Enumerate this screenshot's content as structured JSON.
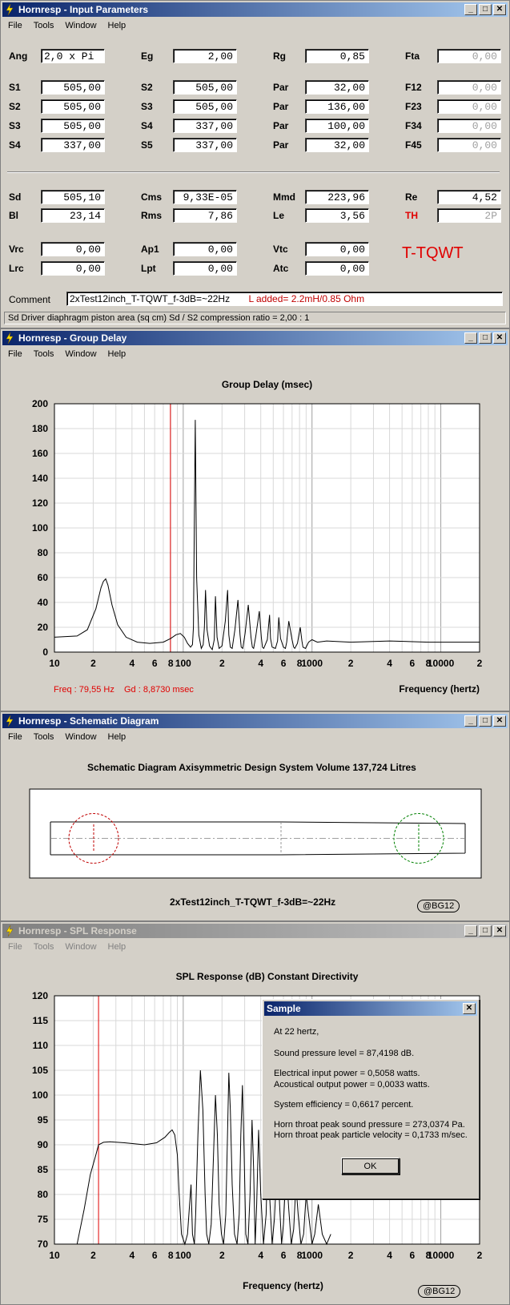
{
  "win1": {
    "title": "Hornresp - Input Parameters",
    "menu": [
      "File",
      "Tools",
      "Window",
      "Help"
    ],
    "rows1": [
      [
        {
          "l": "Ang",
          "v": "2,0 x Pi",
          "left": true
        },
        {
          "l": "Eg",
          "v": "2,00"
        },
        {
          "l": "Rg",
          "v": "0,85"
        },
        {
          "l": "Fta",
          "v": "0,00",
          "dis": true
        }
      ],
      [
        {
          "l": "S1",
          "v": "505,00"
        },
        {
          "l": "S2",
          "v": "505,00"
        },
        {
          "l": "Par",
          "v": "32,00"
        },
        {
          "l": "F12",
          "v": "0,00",
          "dis": true
        }
      ],
      [
        {
          "l": "S2",
          "v": "505,00"
        },
        {
          "l": "S3",
          "v": "505,00"
        },
        {
          "l": "Par",
          "v": "136,00"
        },
        {
          "l": "F23",
          "v": "0,00",
          "dis": true
        }
      ],
      [
        {
          "l": "S3",
          "v": "505,00"
        },
        {
          "l": "S4",
          "v": "337,00"
        },
        {
          "l": "Par",
          "v": "100,00"
        },
        {
          "l": "F34",
          "v": "0,00",
          "dis": true
        }
      ],
      [
        {
          "l": "S4",
          "v": "337,00"
        },
        {
          "l": "S5",
          "v": "337,00"
        },
        {
          "l": "Par",
          "v": "32,00"
        },
        {
          "l": "F45",
          "v": "0,00",
          "dis": true
        }
      ]
    ],
    "rows2": [
      [
        {
          "l": "Sd",
          "v": "505,10"
        },
        {
          "l": "Cms",
          "v": "9,33E-05"
        },
        {
          "l": "Mmd",
          "v": "223,96"
        },
        {
          "l": "Re",
          "v": "4,52"
        }
      ],
      [
        {
          "l": "Bl",
          "v": "23,14"
        },
        {
          "l": "Rms",
          "v": "7,86"
        },
        {
          "l": "Le",
          "v": "3,56"
        },
        {
          "l": "TH",
          "v": "2P",
          "dis": true,
          "red": true
        }
      ],
      [
        {
          "l": "Vrc",
          "v": "0,00"
        },
        {
          "l": "Ap1",
          "v": "0,00"
        },
        {
          "l": "Vtc",
          "v": "0,00"
        }
      ],
      [
        {
          "l": "Lrc",
          "v": "0,00"
        },
        {
          "l": "Lpt",
          "v": "0,00"
        },
        {
          "l": "Atc",
          "v": "0,00"
        }
      ]
    ],
    "big_label": "T-TQWT",
    "comment_label": "Comment",
    "comment_value": "2xTest12inch_T-TQWT_f-3dB=~22Hz",
    "comment_note": "L added= 2.2mH/0.85 Ohm",
    "status": "Sd   Driver diaphragm piston area  (sq cm)   Sd / S2 compression ratio = 2,00 : 1"
  },
  "win2": {
    "title": "Hornresp - Group Delay",
    "menu": [
      "File",
      "Tools",
      "Window",
      "Help"
    ],
    "cursor_freq": "Freq : 79,55 Hz",
    "cursor_gd": "Gd : 8,8730 msec"
  },
  "win3": {
    "title": "Hornresp - Schematic Diagram",
    "menu": [
      "File",
      "Tools",
      "Window",
      "Help"
    ],
    "heading": "Schematic Diagram   Axisymmetric Design   System Volume 137,724 Litres",
    "caption": "2xTest12inch_T-TQWT_f-3dB=~22Hz",
    "badge": "@BG12"
  },
  "win4": {
    "title": "Hornresp - SPL Response",
    "menu": [
      "File",
      "Tools",
      "Window",
      "Help"
    ],
    "badge": "@BG12"
  },
  "dialog": {
    "title": "Sample",
    "lines": [
      "At 22 hertz,",
      "Sound pressure level = 87,4198 dB.",
      "Electrical input power = 0,5058 watts.",
      "Acoustical output power = 0,0033 watts.",
      "System efficiency = 0,6617 percent.",
      "Horn throat peak sound pressure = 273,0374 Pa.",
      "Horn throat peak particle velocity = 0,1733 m/sec."
    ],
    "ok": "OK"
  },
  "chart_data": [
    {
      "type": "line",
      "title": "Group Delay (msec)",
      "xlabel": "Frequency (hertz)",
      "ylabel": "",
      "xscale": "log",
      "xlim": [
        10,
        20000
      ],
      "ylim": [
        0,
        200
      ],
      "yticks": [
        0,
        20,
        40,
        60,
        80,
        100,
        120,
        140,
        160,
        180,
        200
      ],
      "xtick_labels": [
        "10",
        "2",
        "4",
        "6",
        "8",
        "100",
        "2",
        "4",
        "6",
        "8",
        "1000",
        "2",
        "4",
        "6",
        "8",
        "10000",
        "2"
      ],
      "grid": true,
      "cursor_x": 79.55,
      "series": [
        {
          "x": [
            10,
            15,
            18,
            21,
            23,
            24,
            25,
            26,
            28,
            31,
            36,
            44,
            55,
            70,
            80,
            88,
            95,
            102,
            108,
            114,
            118,
            120,
            122,
            124,
            127,
            132,
            138,
            143,
            146,
            149,
            153,
            160,
            168,
            174,
            178,
            183,
            190,
            200,
            212,
            221,
            226,
            232,
            240,
            252,
            266,
            276,
            282,
            290,
            302,
            320,
            336,
            344,
            352,
            365,
            390,
            404,
            412,
            422,
            450,
            468,
            476,
            490,
            520,
            540,
            552,
            570,
            600,
            622,
            636,
            660,
            700,
            720,
            735,
            770,
            810,
            835,
            850,
            890,
            940,
            1000,
            1100,
            1300,
            2000,
            4000,
            8000,
            20000
          ],
          "y": [
            12,
            13,
            18,
            35,
            52,
            57,
            59,
            54,
            38,
            22,
            12,
            8,
            7,
            8,
            11,
            14,
            15,
            12,
            7,
            4,
            6,
            20,
            110,
            187,
            60,
            14,
            3,
            6,
            20,
            50,
            18,
            5,
            2,
            10,
            45,
            12,
            3,
            5,
            25,
            50,
            14,
            4,
            3,
            18,
            42,
            14,
            4,
            3,
            15,
            38,
            12,
            4,
            3,
            12,
            33,
            12,
            4,
            3,
            10,
            30,
            11,
            4,
            3,
            9,
            28,
            11,
            4,
            3,
            8,
            25,
            10,
            4,
            3,
            7,
            20,
            9,
            4,
            3,
            8,
            10,
            8,
            9,
            8,
            9,
            8,
            8
          ]
        }
      ]
    },
    {
      "type": "line",
      "title": "SPL Response (dB)   Constant Directivity",
      "xlabel": "Frequency (hertz)",
      "ylabel": "",
      "xscale": "log",
      "xlim": [
        10,
        20000
      ],
      "ylim": [
        70,
        120
      ],
      "yticks": [
        70,
        75,
        80,
        85,
        90,
        95,
        100,
        105,
        110,
        115,
        120
      ],
      "xtick_labels": [
        "10",
        "2",
        "4",
        "6",
        "8",
        "100",
        "2",
        "4",
        "6",
        "8",
        "1000",
        "2",
        "4",
        "6",
        "8",
        "10000",
        "2"
      ],
      "grid": true,
      "cursor_x": 22,
      "series": [
        {
          "x": [
            15,
            17,
            19,
            21,
            22,
            24,
            27,
            35,
            50,
            62,
            72,
            78,
            82,
            86,
            90,
            93,
            97,
            103,
            108,
            112,
            115,
            118,
            122,
            125,
            130,
            136,
            142,
            148,
            152,
            158,
            165,
            172,
            178,
            184,
            190,
            198,
            206,
            214,
            220,
            226,
            232,
            240,
            250,
            262,
            272,
            280,
            288,
            296,
            306,
            318,
            330,
            342,
            352,
            362,
            372,
            385,
            400,
            420,
            440,
            455,
            470,
            490,
            510,
            540,
            560,
            580,
            600,
            630,
            660,
            690,
            720,
            750,
            780,
            820,
            860,
            900,
            950,
            1000,
            1050,
            1120,
            1200,
            1300,
            1400
          ],
          "y": [
            70,
            77,
            84,
            88,
            90,
            90.5,
            90.6,
            90.4,
            90,
            90.4,
            91.5,
            92.5,
            93,
            92,
            88,
            80,
            72,
            70,
            72,
            78,
            82,
            72,
            70,
            76,
            92,
            105,
            97,
            80,
            72,
            70,
            74,
            88,
            100,
            92,
            78,
            72,
            70,
            76,
            90,
            104.5,
            97,
            82,
            72,
            70,
            76,
            92,
            102,
            90,
            72,
            70,
            80,
            95,
            85,
            70,
            78,
            93,
            80,
            70,
            76,
            90,
            79,
            70,
            75,
            88,
            78,
            70,
            74,
            85,
            77,
            70,
            73,
            82,
            76,
            70,
            72,
            80,
            75,
            70,
            72,
            78,
            72,
            70,
            72
          ]
        }
      ]
    }
  ]
}
